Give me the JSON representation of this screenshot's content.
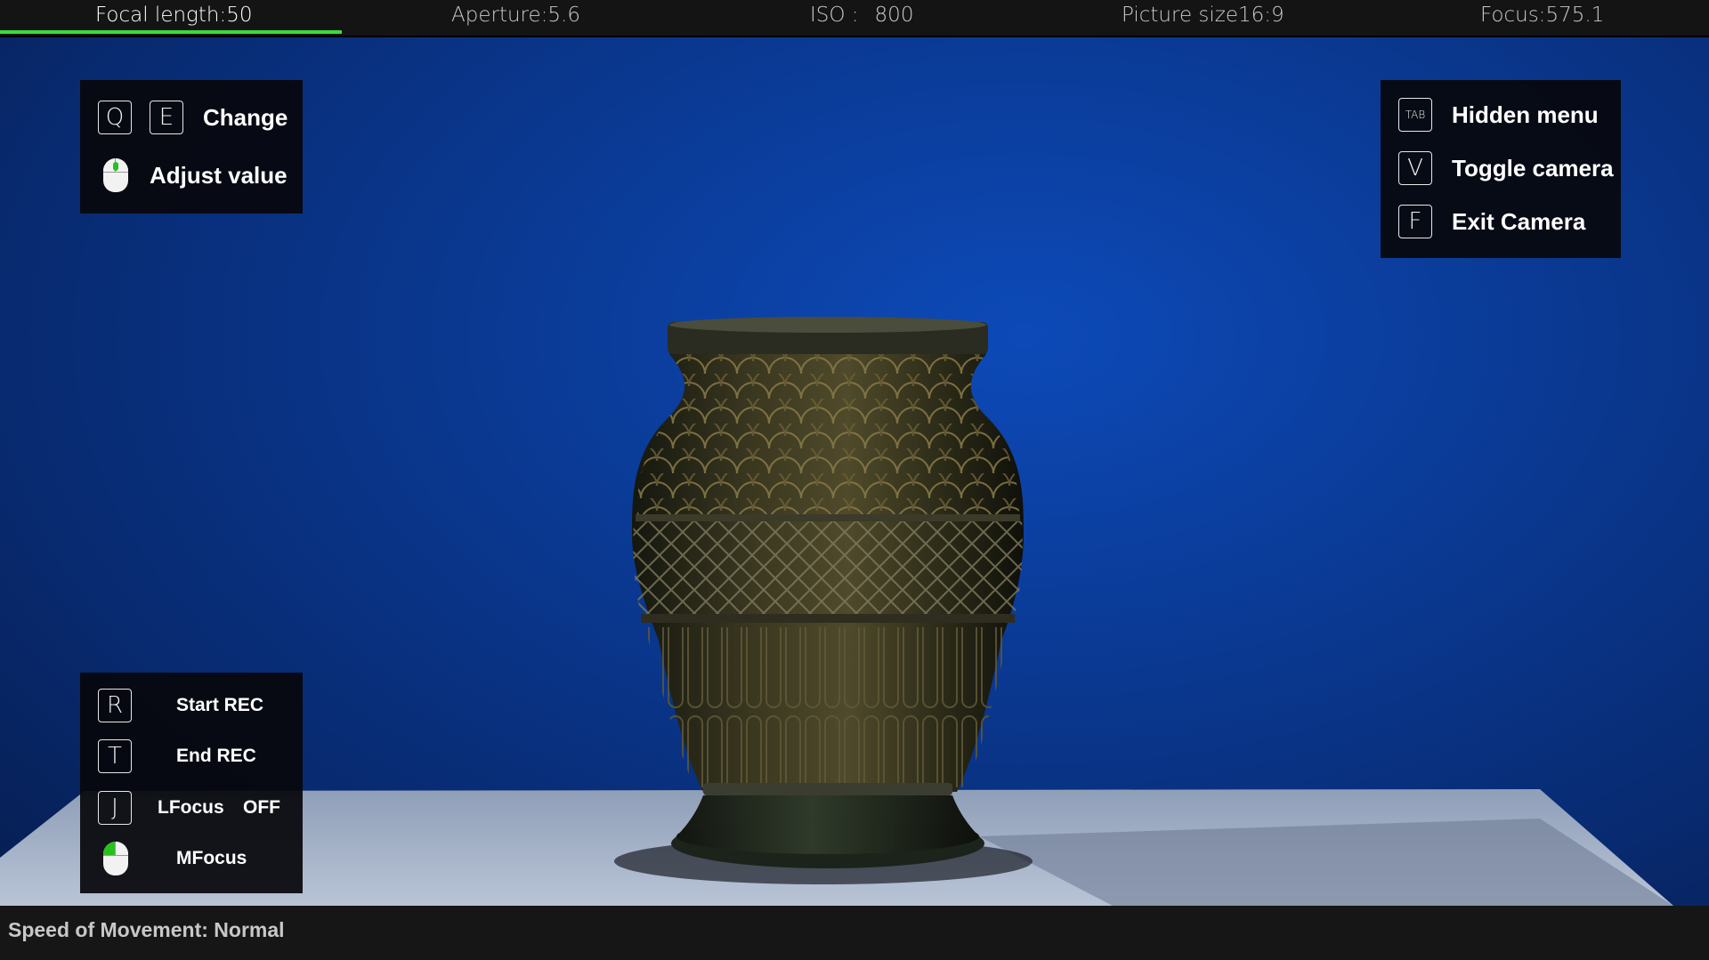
{
  "topbar": {
    "items": [
      {
        "label": "Focal length:",
        "value": "50"
      },
      {
        "label": "Aperture:",
        "value": "5.6"
      },
      {
        "label": "ISO :",
        "value": "800"
      },
      {
        "label": "Picture size",
        "value": "16:9"
      },
      {
        "label": "Focus:",
        "value": "575.1"
      }
    ],
    "active_index": 0,
    "progress_fraction": 0.2
  },
  "panel_top_left": {
    "keys": [
      "Q",
      "E"
    ],
    "change_label": "Change",
    "adjust_label": "Adjust value"
  },
  "panel_top_right": {
    "rows": [
      {
        "key": "TAB",
        "label": "Hidden menu"
      },
      {
        "key": "V",
        "label": "Toggle camera"
      },
      {
        "key": "F",
        "label": "Exit Camera"
      }
    ]
  },
  "panel_bottom_left": {
    "rows": [
      {
        "key": "R",
        "label": "Start REC"
      },
      {
        "key": "T",
        "label": "End REC"
      },
      {
        "key": "J",
        "label": "LFocus",
        "state": "OFF"
      },
      {
        "key": "mouse",
        "label": "MFocus"
      }
    ]
  },
  "bottombar": {
    "speed_text": "Speed of Movement: Normal"
  },
  "colors": {
    "accent_green": "#3ddc3a",
    "background_blue": "#0a3a95"
  },
  "icons": {
    "mouse": "mouse-icon"
  }
}
